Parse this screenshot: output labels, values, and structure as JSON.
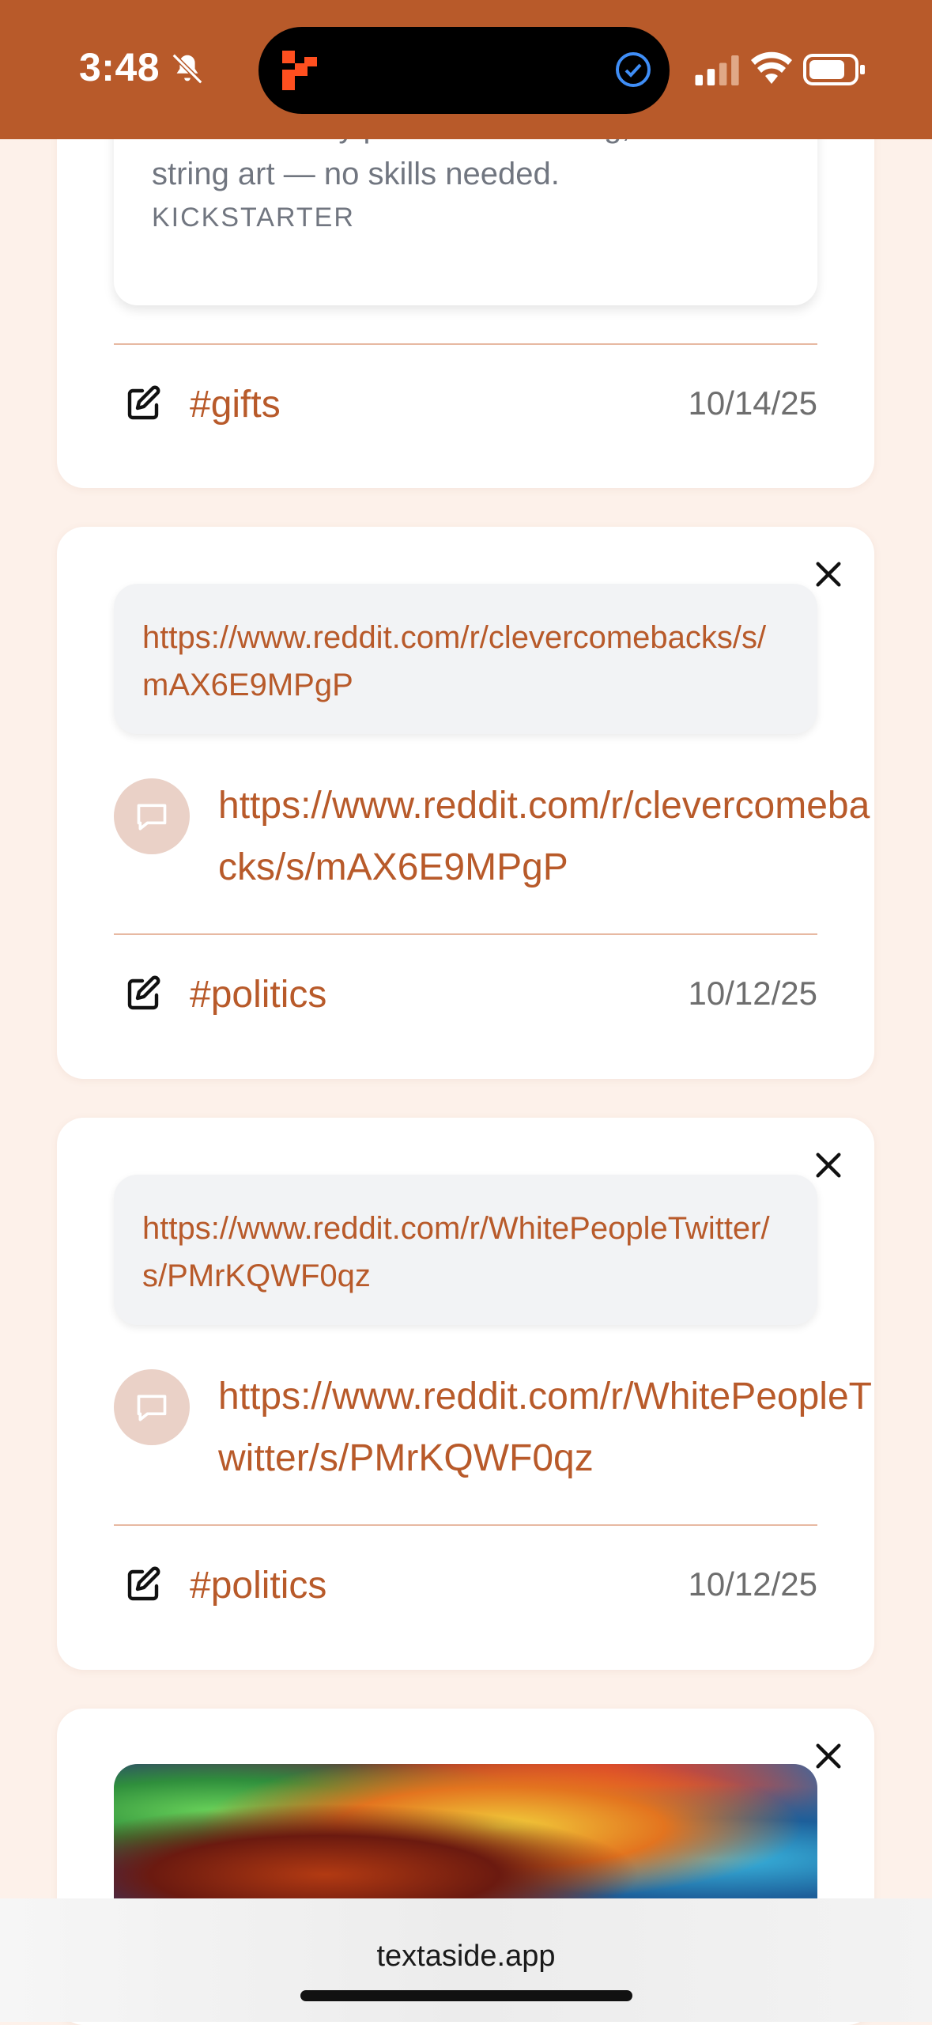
{
  "status_bar": {
    "time": "3:48",
    "background_color": "#b85a2a",
    "icons": [
      "bell-muted-icon",
      "app-icon",
      "check-circle-icon",
      "signal-icon",
      "wifi-icon",
      "battery-icon"
    ]
  },
  "cards": [
    {
      "preview": {
        "description": "Transform any photo into relaxing, custom string art — no skills needed.",
        "source": "KICKSTARTER"
      },
      "tag": "#gifts",
      "date": "10/14/25"
    },
    {
      "preview_url": "https://www.reddit.com/r/clevercomebacks/s/mAX6E9MPgP",
      "comment": "https://www.reddit.com/r/clevercomebacks/s/mAX6E9MPgP",
      "tag": "#politics",
      "date": "10/12/25"
    },
    {
      "preview_url": "https://www.reddit.com/r/WhitePeopleTwitter/s/PMrKQWF0qz",
      "comment": "https://www.reddit.com/r/WhitePeopleTwitter/s/PMrKQWF0qz",
      "tag": "#politics",
      "date": "10/12/25"
    },
    {
      "image_preview": "colorful-nebula-image"
    }
  ],
  "browser": {
    "url": "textaside.app"
  },
  "colors": {
    "accent": "#b85a2a",
    "page_background": "#fdf1ea",
    "divider": "#e7b9a2"
  }
}
